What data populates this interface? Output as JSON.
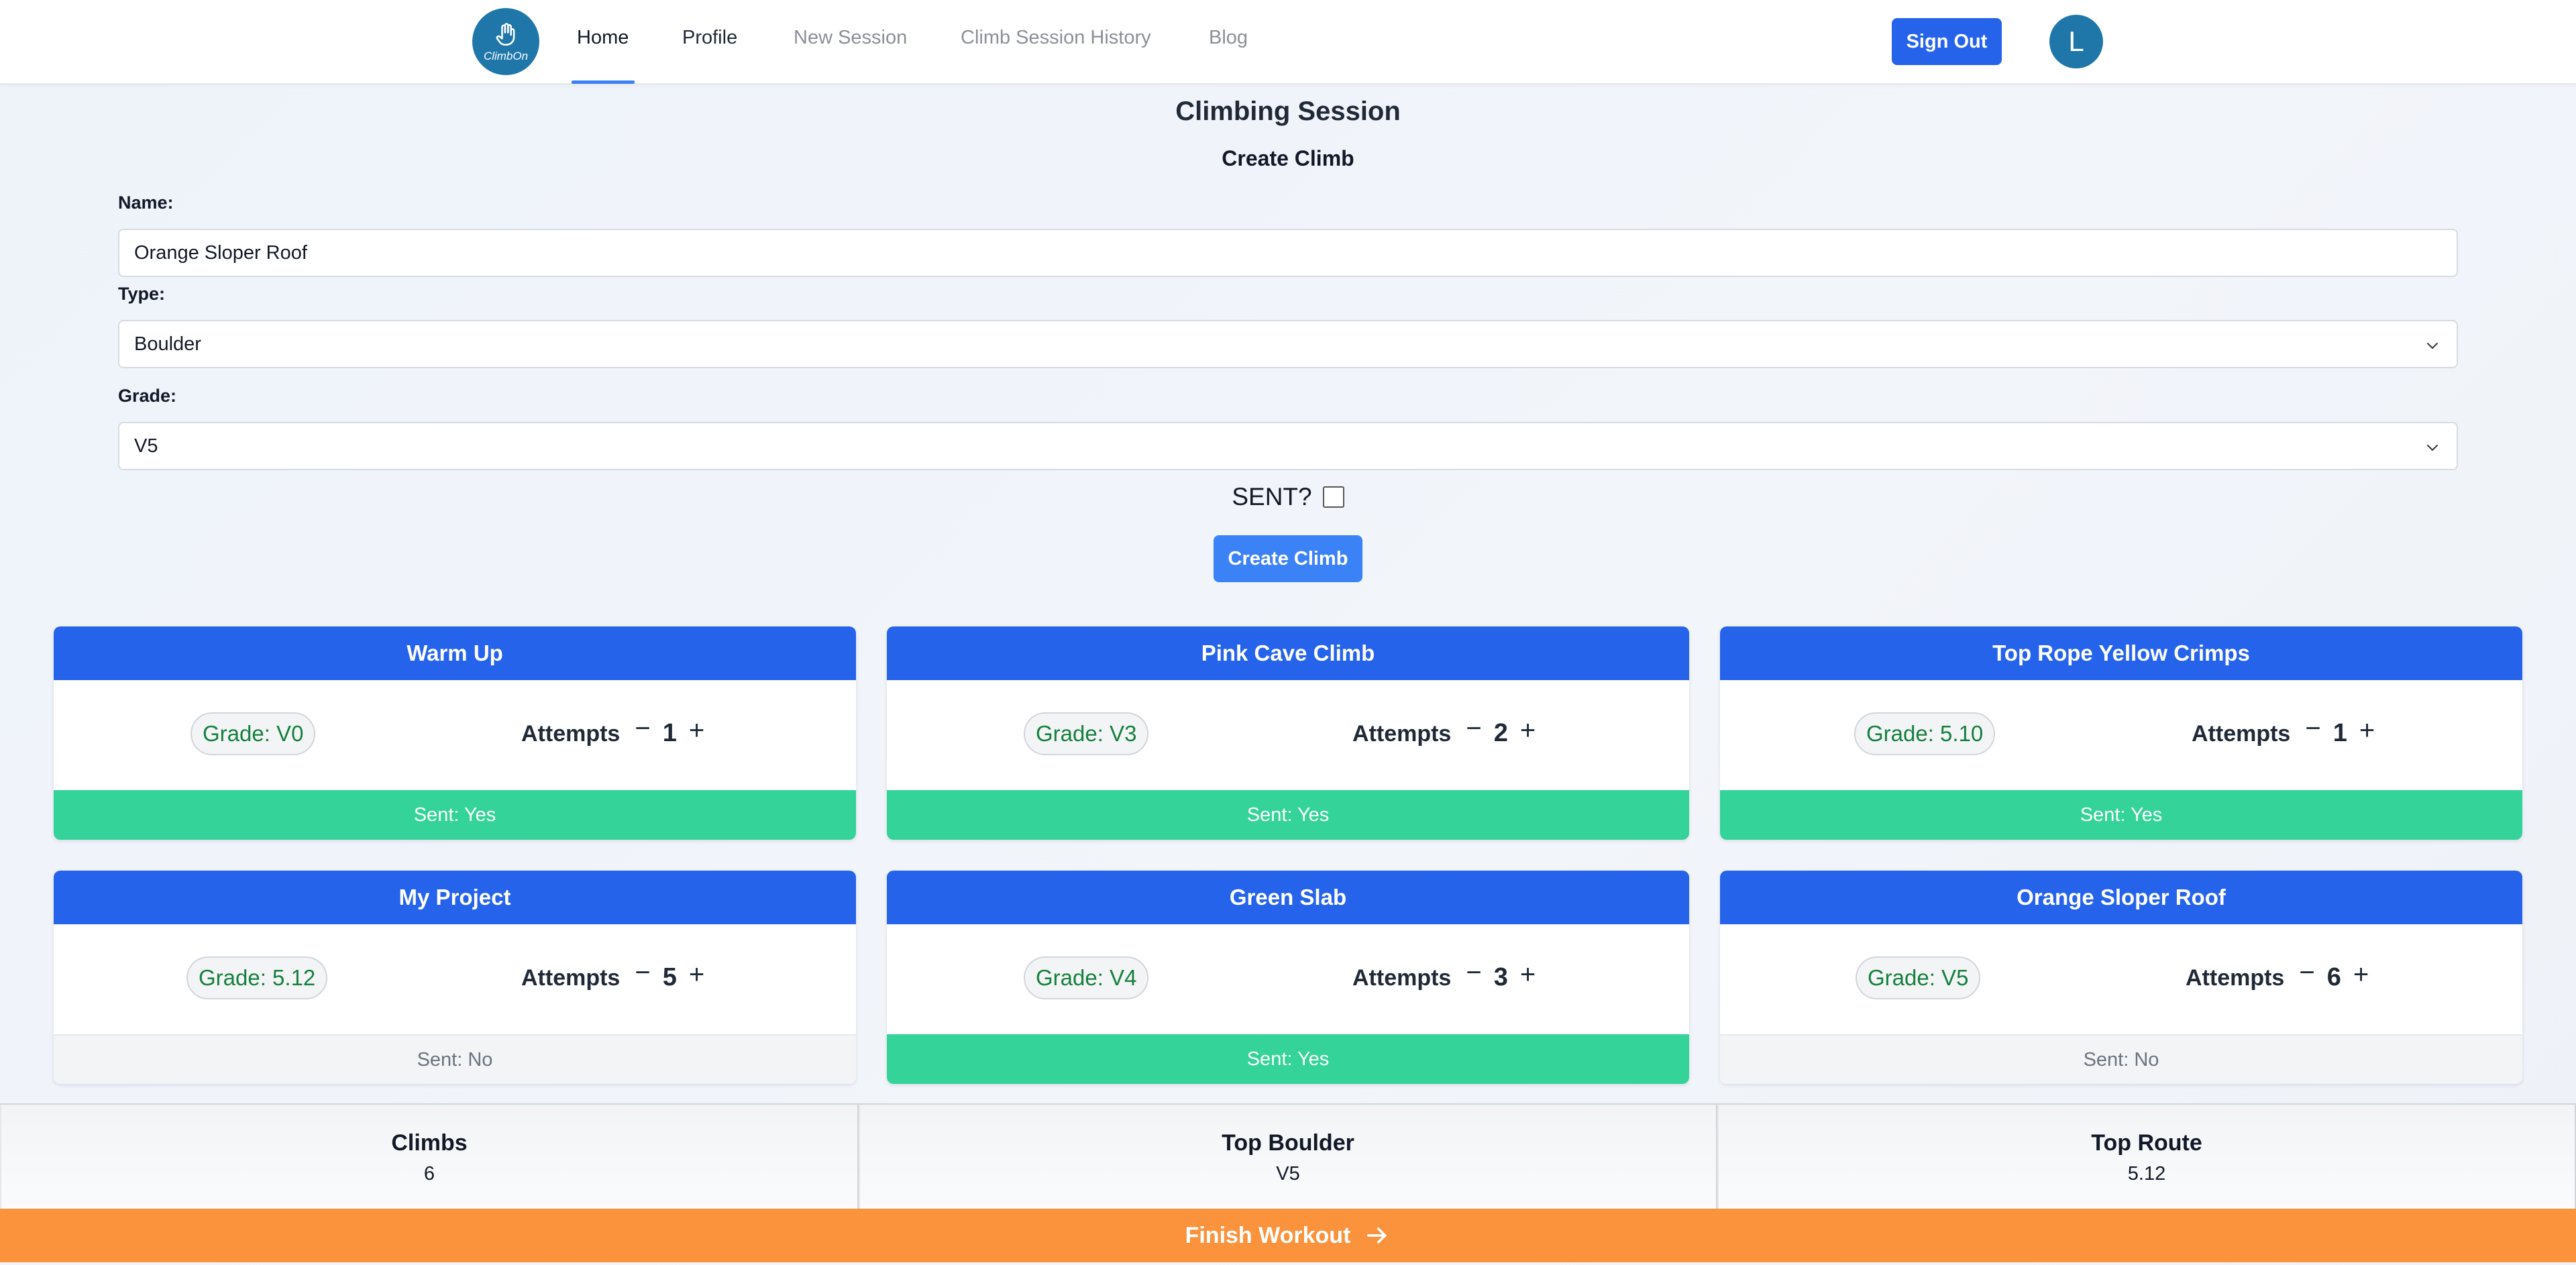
{
  "nav": {
    "logo_text": "ClimbOn",
    "links": [
      "Home",
      "Profile",
      "New Session",
      "Climb Session History",
      "Blog"
    ],
    "sign_out": "Sign Out",
    "avatar_initial": "L"
  },
  "page": {
    "title": "Climbing Session",
    "section": "Create Climb"
  },
  "form": {
    "name_label": "Name:",
    "name_value": "Orange Sloper Roof",
    "type_label": "Type:",
    "type_value": "Boulder",
    "grade_label": "Grade:",
    "grade_value": "V5",
    "sent_label": "SENT?",
    "sent_checked": false,
    "create_button": "Create Climb"
  },
  "climbs": [
    {
      "name": "Warm Up",
      "grade": "Grade: V0",
      "attempts_label": "Attempts",
      "attempts": "1",
      "sent": "Sent: Yes",
      "sent_yes": true
    },
    {
      "name": "Pink Cave Climb",
      "grade": "Grade: V3",
      "attempts_label": "Attempts",
      "attempts": "2",
      "sent": "Sent: Yes",
      "sent_yes": true
    },
    {
      "name": "Top Rope Yellow Crimps",
      "grade": "Grade: 5.10",
      "attempts_label": "Attempts",
      "attempts": "1",
      "sent": "Sent: Yes",
      "sent_yes": true
    },
    {
      "name": "My Project",
      "grade": "Grade: 5.12",
      "attempts_label": "Attempts",
      "attempts": "5",
      "sent": "Sent: No",
      "sent_yes": false
    },
    {
      "name": "Green Slab",
      "grade": "Grade: V4",
      "attempts_label": "Attempts",
      "attempts": "3",
      "sent": "Sent: Yes",
      "sent_yes": true
    },
    {
      "name": "Orange Sloper Roof",
      "grade": "Grade: V5",
      "attempts_label": "Attempts",
      "attempts": "6",
      "sent": "Sent: No",
      "sent_yes": false
    }
  ],
  "stats": [
    {
      "title": "Climbs",
      "value": "6"
    },
    {
      "title": "Top Boulder",
      "value": "V5"
    },
    {
      "title": "Top Route",
      "value": "5.12"
    }
  ],
  "finish_button": "Finish Workout",
  "colors": {
    "primary": "#2563eb",
    "sent_yes": "#34d399",
    "finish": "#fb923c",
    "logo": "#1f77a9"
  }
}
